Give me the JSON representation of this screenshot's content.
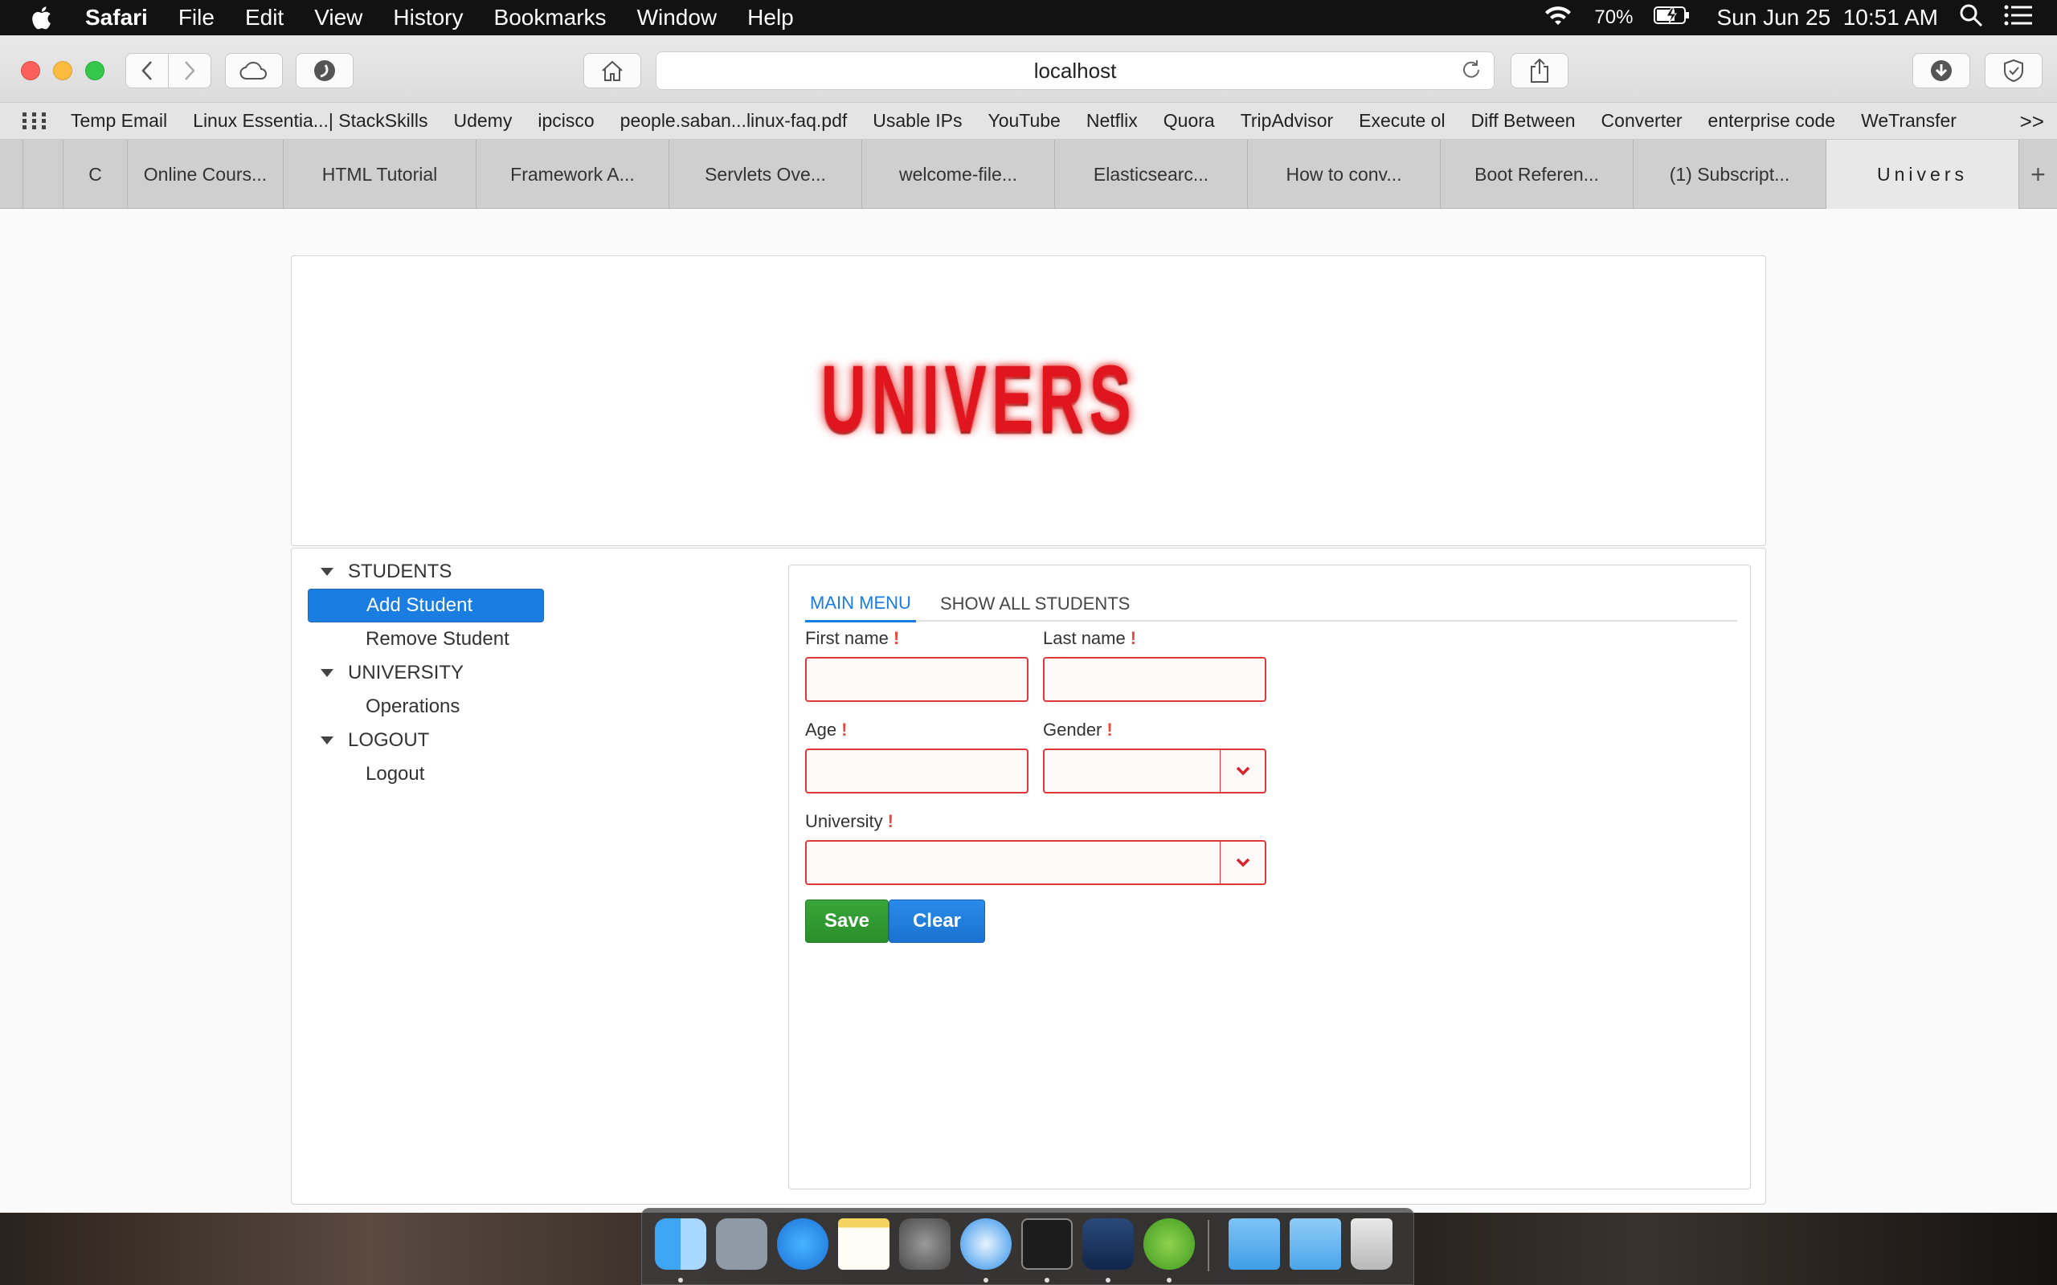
{
  "menubar": {
    "app_name": "Safari",
    "items": [
      "File",
      "Edit",
      "View",
      "History",
      "Bookmarks",
      "Window",
      "Help"
    ],
    "battery": "70%",
    "clock": "Sun Jun 25  10:51 AM"
  },
  "browser": {
    "address": "localhost",
    "bookmarks": [
      "Temp Email",
      "Linux Essentia...| StackSkills",
      "Udemy",
      "ipcisco",
      "people.saban...linux-faq.pdf",
      "Usable IPs",
      "YouTube",
      "Netflix",
      "Quora",
      "TripAdvisor",
      "Execute ol",
      "Diff Between",
      "Converter",
      "enterprise code",
      "WeTransfer"
    ],
    "more_bookmarks": ">>",
    "tabs": [
      "C",
      "Online Cours...",
      "HTML Tutorial",
      "Framework A...",
      "Servlets Ove...",
      "welcome-file...",
      "Elasticsearc...",
      "How to conv...",
      "Boot Referen...",
      "(1) Subscript...",
      "Univers"
    ],
    "new_tab": "+"
  },
  "app": {
    "logo_letters": [
      "U",
      "N",
      "I",
      "V",
      "E",
      "R",
      "S"
    ],
    "tree": {
      "students": "STUDENTS",
      "add_student": "Add Student",
      "remove_student": "Remove Student",
      "university": "UNIVERSITY",
      "operations": "Operations",
      "logout_group": "LOGOUT",
      "logout": "Logout"
    },
    "tabs": {
      "main_menu": "MAIN MENU",
      "show_all": "SHOW ALL STUDENTS"
    },
    "form": {
      "first_name_label": "First name",
      "last_name_label": "Last name",
      "age_label": "Age",
      "gender_label": "Gender",
      "university_label": "University",
      "required_marker": "!",
      "first_name_value": "",
      "last_name_value": "",
      "age_value": "",
      "gender_value": "",
      "university_value": ""
    },
    "buttons": {
      "save": "Save",
      "clear": "Clear"
    }
  },
  "colors": {
    "accent": "#197de1",
    "save": "#2e952e",
    "error": "#e0383a",
    "logo": "#e0151d"
  }
}
